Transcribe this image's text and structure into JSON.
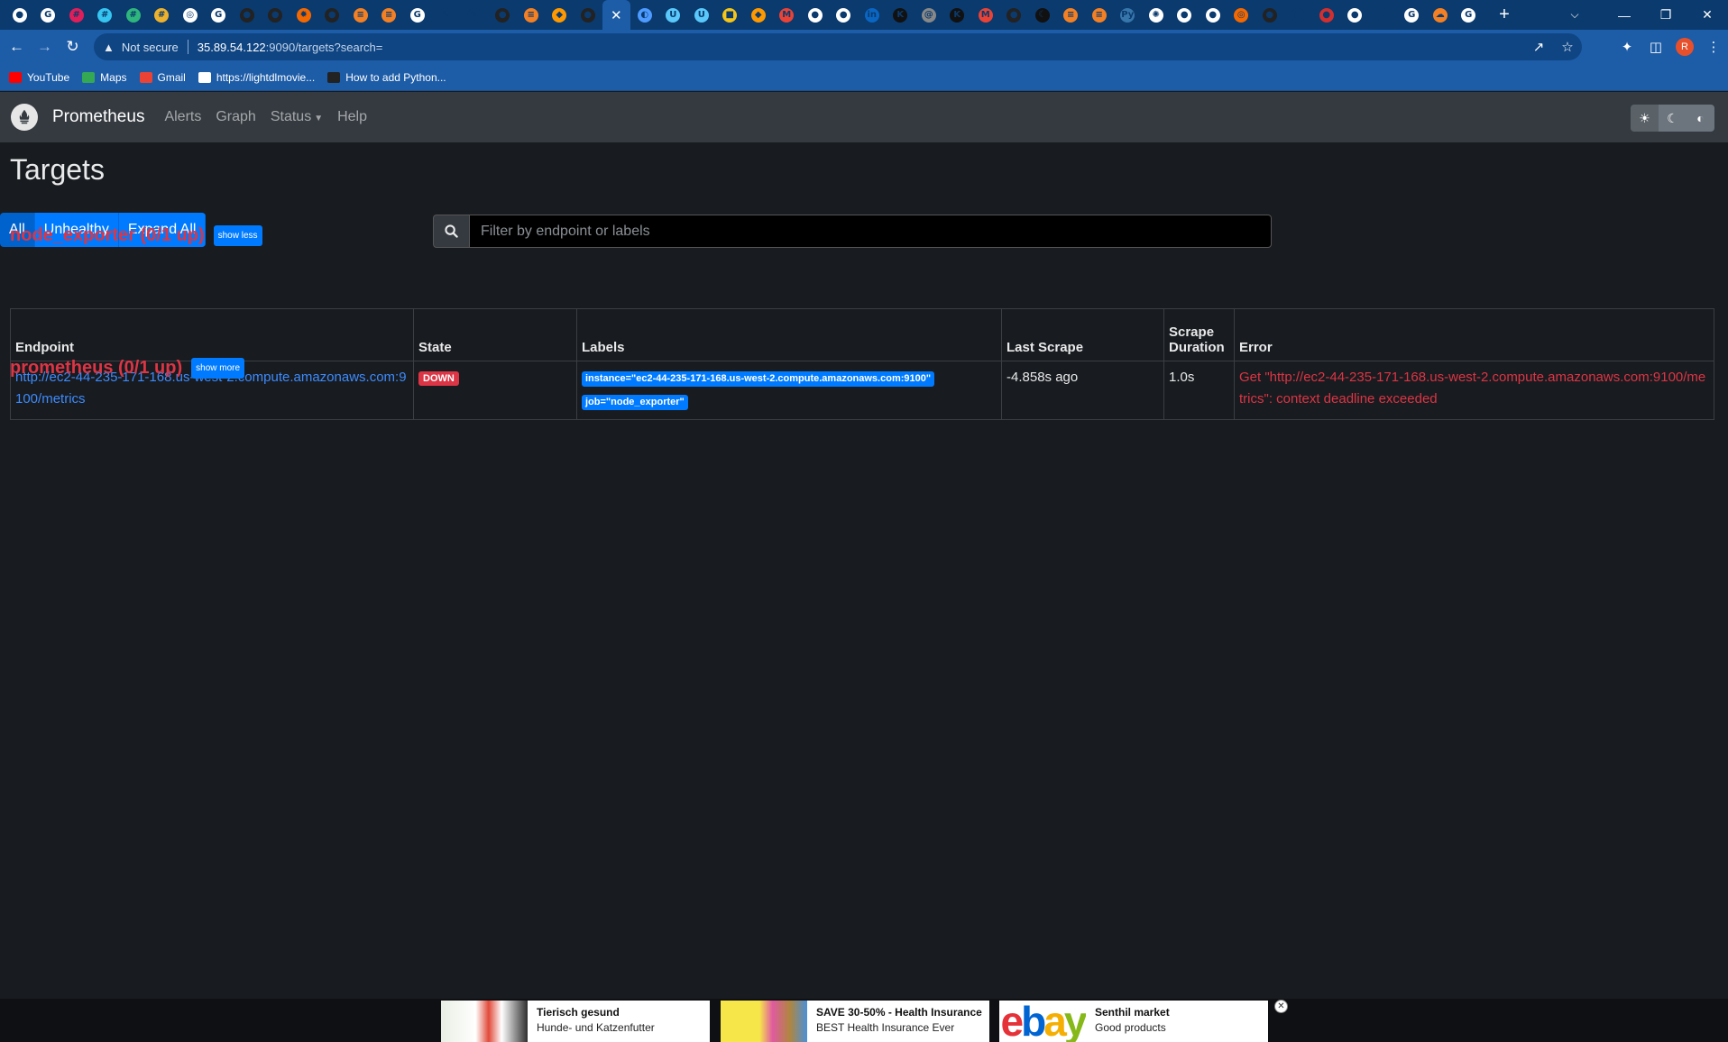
{
  "browser": {
    "tabs": [
      {
        "icon": "github-icon",
        "color": "#ffffff",
        "glyph": "●"
      },
      {
        "icon": "chrome-icon",
        "color": "#ffffff",
        "glyph": "G"
      },
      {
        "icon": "slack-icon",
        "color": "#e01e5a",
        "glyph": "#"
      },
      {
        "icon": "slack-icon",
        "color": "#36c5f0",
        "glyph": "#"
      },
      {
        "icon": "slack-icon",
        "color": "#2eb67d",
        "glyph": "#"
      },
      {
        "icon": "slack-icon",
        "color": "#ecb22e",
        "glyph": "#"
      },
      {
        "icon": "refresh-circle-icon",
        "color": "#ffffff",
        "glyph": "◎"
      },
      {
        "icon": "chrome-icon",
        "color": "#ffffff",
        "glyph": "G"
      },
      {
        "icon": "github-icon",
        "color": "#222222",
        "glyph": "●"
      },
      {
        "icon": "github-icon",
        "color": "#222222",
        "glyph": "●"
      },
      {
        "icon": "grafana-icon",
        "color": "#f46800",
        "glyph": "✹"
      },
      {
        "icon": "github-icon",
        "color": "#222222",
        "glyph": "●"
      },
      {
        "icon": "stackoverflow-icon",
        "color": "#f48024",
        "glyph": "≡"
      },
      {
        "icon": "stackoverflow-icon",
        "color": "#f48024",
        "glyph": "≡"
      },
      {
        "icon": "google-icon",
        "color": "#ffffff",
        "glyph": "G"
      },
      {
        "icon": "pen-icon",
        "color": "#0a3a6e",
        "glyph": "✎"
      },
      {
        "icon": "pen-icon",
        "color": "#0a3a6e",
        "glyph": "✎"
      },
      {
        "icon": "github-icon",
        "color": "#222222",
        "glyph": "●"
      },
      {
        "icon": "stackoverflow-icon",
        "color": "#f48024",
        "glyph": "≡"
      },
      {
        "icon": "aws-icon",
        "color": "#ff9900",
        "glyph": "◆"
      },
      {
        "icon": "github-icon",
        "color": "#222222",
        "glyph": "●"
      }
    ],
    "active_tab_close": "✕",
    "tabs_right": [
      {
        "icon": "loading-icon",
        "color": "#4d9bff",
        "glyph": "◐"
      },
      {
        "icon": "udemy-icon",
        "color": "#5ac8fa",
        "glyph": "U"
      },
      {
        "icon": "udemy-icon",
        "color": "#5ac8fa",
        "glyph": "U"
      },
      {
        "icon": "box-icon",
        "color": "#f5c518",
        "glyph": "■"
      },
      {
        "icon": "aws-icon",
        "color": "#ff9900",
        "glyph": "◆"
      },
      {
        "icon": "gmail-icon",
        "color": "#ea4335",
        "glyph": "M"
      },
      {
        "icon": "github-icon",
        "color": "#ffffff",
        "glyph": "●"
      },
      {
        "icon": "github-icon",
        "color": "#ffffff",
        "glyph": "●"
      },
      {
        "icon": "linkedin-icon",
        "color": "#0a66c2",
        "glyph": "in"
      },
      {
        "icon": "k-icon",
        "color": "#111111",
        "glyph": "K"
      },
      {
        "icon": "at-icon",
        "color": "#888888",
        "glyph": "@"
      },
      {
        "icon": "k-icon",
        "color": "#111111",
        "glyph": "K"
      },
      {
        "icon": "gmail-icon",
        "color": "#ea4335",
        "glyph": "M"
      },
      {
        "icon": "github-icon",
        "color": "#222222",
        "glyph": "●"
      },
      {
        "icon": "moon-icon",
        "color": "#111111",
        "glyph": "☾"
      },
      {
        "icon": "stackoverflow-icon",
        "color": "#f48024",
        "glyph": "≡"
      },
      {
        "icon": "stackoverflow-icon",
        "color": "#f48024",
        "glyph": "≡"
      },
      {
        "icon": "python-icon",
        "color": "#3776ab",
        "glyph": "Py"
      },
      {
        "icon": "openai-icon",
        "color": "#ffffff",
        "glyph": "✺"
      },
      {
        "icon": "github-icon",
        "color": "#ffffff",
        "glyph": "●"
      },
      {
        "icon": "github-icon",
        "color": "#ffffff",
        "glyph": "●"
      },
      {
        "icon": "target-icon",
        "color": "#f46800",
        "glyph": "◎"
      },
      {
        "icon": "github-icon",
        "color": "#222222",
        "glyph": "●"
      },
      {
        "icon": "page-icon",
        "color": "#0a3a6e",
        "glyph": "▢"
      },
      {
        "icon": "red-circle-icon",
        "color": "#d32f2f",
        "glyph": "●"
      },
      {
        "icon": "drop-icon",
        "color": "#ffffff",
        "glyph": "●"
      },
      {
        "icon": "blank-icon",
        "color": "#0a3a6e",
        "glyph": ""
      },
      {
        "icon": "google-icon",
        "color": "#ffffff",
        "glyph": "G"
      },
      {
        "icon": "cloud-icon",
        "color": "#f48024",
        "glyph": "☁"
      },
      {
        "icon": "google-icon",
        "color": "#ffffff",
        "glyph": "G"
      }
    ],
    "new_tab": "+",
    "window_controls": [
      "⌵",
      "—",
      "❐",
      "✕"
    ],
    "address": {
      "security_label": "Not secure",
      "host": "35.89.54.122",
      "path": ":9090/targets?search="
    },
    "bookmarks": [
      {
        "label": "YouTube",
        "icon": "youtube-icon",
        "color": "#ff0000"
      },
      {
        "label": "Maps",
        "icon": "maps-icon",
        "color": "#34a853"
      },
      {
        "label": "Gmail",
        "icon": "gmail-icon",
        "color": "#ea4335"
      },
      {
        "label": "https://lightdlmovie...",
        "icon": "download-icon",
        "color": "#ffffff"
      },
      {
        "label": "How to add Python...",
        "icon": "python-doc-icon",
        "color": "#222222"
      }
    ]
  },
  "app": {
    "brand": "Prometheus",
    "nav": [
      "Alerts",
      "Graph",
      "Status",
      "Help"
    ],
    "page_title": "Targets",
    "filter_buttons": [
      "All",
      "Unhealthy",
      "Expand All"
    ],
    "search_placeholder": "Filter by endpoint or labels",
    "pools": [
      {
        "title": "node_exporter (0/1 up)",
        "toggle": "show less",
        "columns": [
          "Endpoint",
          "State",
          "Labels",
          "Last Scrape",
          "Scrape Duration",
          "Error"
        ],
        "rows": [
          {
            "endpoint": "http://ec2-44-235-171-168.us-west-2.compute.amazonaws.com:9100/metrics",
            "state": "DOWN",
            "labels": [
              "instance=\"ec2-44-235-171-168.us-west-2.compute.amazonaws.com:9100\"",
              "job=\"node_exporter\""
            ],
            "last_scrape": "-4.858s ago",
            "scrape_duration": "1.0s",
            "error": "Get \"http://ec2-44-235-171-168.us-west-2.compute.amazonaws.com:9100/metrics\": context deadline exceeded"
          }
        ]
      },
      {
        "title": "prometheus (0/1 up)",
        "toggle": "show more"
      }
    ]
  },
  "ads": [
    {
      "title": "Tierisch gesund",
      "subtitle": "Hunde- und Katzenfutter"
    },
    {
      "title": "SAVE 30-50% - Health Insurance",
      "subtitle": "BEST Health Insurance Ever"
    },
    {
      "title": "Senthil market",
      "subtitle": "Good products",
      "brand": "ebay"
    }
  ],
  "colors": {
    "danger": "#dc3545",
    "primary": "#007bff",
    "navbar": "#343a40",
    "background": "#181b1f"
  }
}
